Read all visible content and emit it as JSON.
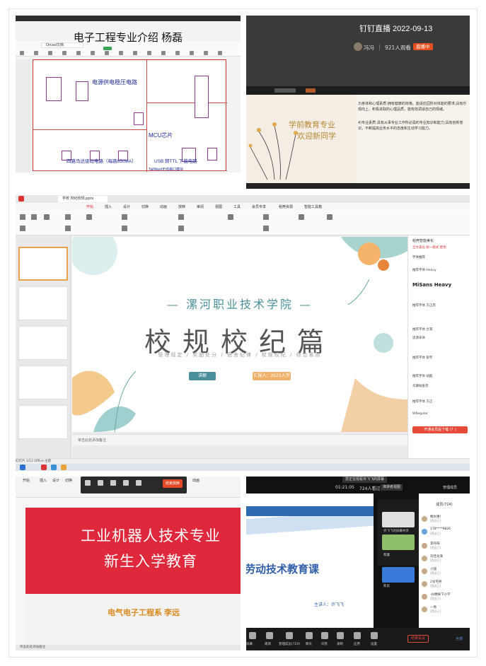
{
  "panel1": {
    "title": "电子工程专业介绍 杨磊",
    "tab_label": "Orcad文档",
    "labels": {
      "power": "电源供电稳压电路",
      "mcu": "MCU芯片",
      "motor": "四路马达驱动电路（每路850MA）",
      "usb": "USB 转TTL 下载电路",
      "bottom": "TailWant无线串口模块"
    }
  },
  "panel2": {
    "live_title": "钉钉直播 2022-09-13",
    "host": "冯冯",
    "separator": "|",
    "viewers": "921人观看",
    "live_badge": "直播中",
    "slide_title_1": "学前教育专业",
    "slide_title_2": "欢迎新同学",
    "slide_text_1": "3)身体和心理素质:拥有健康的体格。能适应园所对体能的要求;具有乐观向上、积极进取的心理品质，能有效调适自己的情绪。",
    "slide_text_2": "4)专业素质:具有从事专业工作所必需的专业知识和能力;具有创新意识，不断提高业务水平的态度和主动学习能力。"
  },
  "panel3": {
    "app_tab": "学校 校纪校规.pptx",
    "menus": [
      "开始",
      "插入",
      "设计",
      "切换",
      "动画",
      "放映",
      "审阅",
      "视图",
      "工具",
      "会员专享",
      "稻壳资源",
      "智能工具箱"
    ],
    "school": "— 漯河职业技术学院 —",
    "big_title": "校规校纪篇",
    "subtitle": "管理规定 / 奖励处分 / 宿舍纪律 / 校规校纪 / 综合素质",
    "btn_left": "讲解",
    "btn_right": "汇报人：2023入学",
    "notes": "单击此处添加备注",
    "statusbar": "幻灯片 1/12   Office 主题",
    "right_panel": {
      "title": "稻壳智能美化",
      "tabs": "全文美化   统一版式   配色",
      "heading": "字体推荐",
      "items": [
        "推荐字体 Heavy",
        "MiSans Heavy",
        "推荐字体 方正黑",
        "推荐字体 仓耳",
        "思源宋体",
        "推荐字体 锐字",
        "推荐字体 站酷",
        "华康俪金黑",
        "推荐字体 方正",
        "WRegular"
      ],
      "apply_button": "开通会员后下载 (？)"
    }
  },
  "panel4": {
    "menus": [
      "开始",
      "插入",
      "设计",
      "切换",
      "动画"
    ],
    "end_button": "结束放映",
    "line1": "工业机器人技术专业",
    "line2": "新生入学教育",
    "department": "电气电子工程系  李远",
    "statusbar": "单击此处添加备注"
  },
  "panel5": {
    "tip": "您正在观看许飞飞的屏幕",
    "timer": "01:21:05",
    "people": "724人看过",
    "view_button": "演讲者视图",
    "manager": "管理成员",
    "course": "劳动技术教育课",
    "speaker": "主讲人：许飞飞",
    "videos": [
      "许飞飞的屏幕共享",
      "蔡蕾",
      "陈思"
    ],
    "chat_header": "成员(724)",
    "members": [
      {
        "name": "桐太嘻!",
        "status": "(我自己)"
      },
      {
        "name": "178****9826",
        "status": "(我自己)"
      },
      {
        "name": "李丹阳",
        "status": "(我自己)"
      },
      {
        "name": "刘佳龙泽",
        "status": "(我自己)"
      },
      {
        "name": "小强",
        "status": "(我自己)"
      },
      {
        "name": "2号宅男",
        "status": "(我自己)"
      },
      {
        "name": "-纠缠掉下小学",
        "status": "(我自己)"
      },
      {
        "name": "一地",
        "status": "(我自己)"
      }
    ],
    "bottom_items": [
      "屏幕",
      "邀请",
      "管理成员(724)",
      "聊天",
      "问卷",
      "录制",
      "应用",
      "设置"
    ],
    "end_meeting": "结束会议",
    "all": "全部"
  }
}
